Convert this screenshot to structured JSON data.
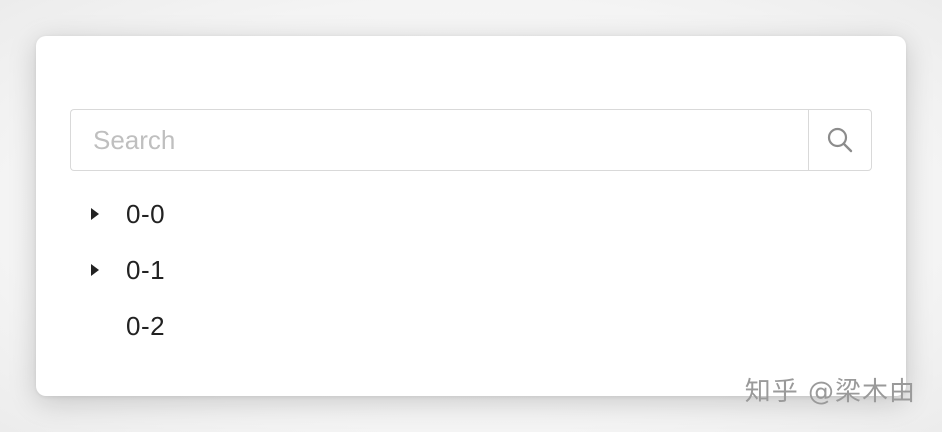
{
  "search": {
    "placeholder": "Search",
    "value": "",
    "button_icon": "search-icon"
  },
  "tree": {
    "nodes": [
      {
        "title": "0-0",
        "expandable": true,
        "expanded": false
      },
      {
        "title": "0-1",
        "expandable": true,
        "expanded": false
      },
      {
        "title": "0-2",
        "expandable": false,
        "expanded": false
      }
    ]
  },
  "watermark": {
    "text": "知乎 @梁木由"
  },
  "colors": {
    "border": "#d9d9d9",
    "placeholder": "#bfbfbf",
    "text": "#222222",
    "icon": "#8c8c8c"
  }
}
